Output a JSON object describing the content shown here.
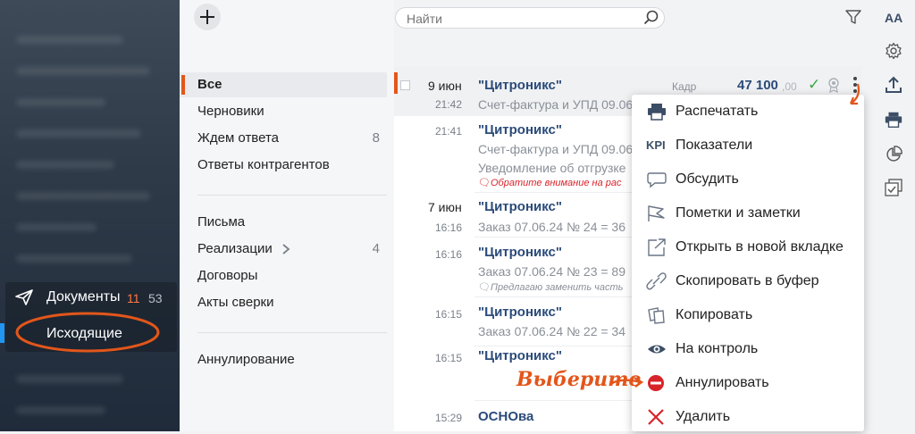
{
  "toolbar": {
    "search_placeholder": "Найти"
  },
  "nav": {
    "documents_label": "Документы",
    "documents_count_new": "11",
    "documents_count_total": "53",
    "outgoing_label": "Исходящие"
  },
  "folders": {
    "group1": [
      {
        "label": "Все",
        "count": ""
      },
      {
        "label": "Черновики",
        "count": ""
      },
      {
        "label": "Ждем ответа",
        "count": "8"
      },
      {
        "label": "Ответы контрагентов",
        "count": ""
      }
    ],
    "group2": [
      {
        "label": "Письма",
        "count": ""
      },
      {
        "label": "Реализации",
        "count": "4"
      },
      {
        "label": "Договоры",
        "count": ""
      },
      {
        "label": "Акты сверки",
        "count": ""
      }
    ],
    "group3": [
      {
        "label": "Аннулирование",
        "count": ""
      }
    ]
  },
  "list": {
    "rows": [
      {
        "date": "9 июн",
        "time": "21:42",
        "title": "\"Цитроникс\"",
        "sub1": "Счет-фактура и УПД 09.06",
        "sub2": "",
        "note": "",
        "tag": "Кадр",
        "amount_int": "47 100",
        "amount_dec": ",00"
      },
      {
        "date": "",
        "time": "21:41",
        "title": "\"Цитроникс\"",
        "sub1": "Счет-фактура и УПД 09.06",
        "sub2": "Уведомление об отгрузке",
        "note": "Обратите внимание на рас"
      },
      {
        "date": "7 июн",
        "time": "16:16",
        "title": "\"Цитроникс\"",
        "sub1": "Заказ 07.06.24 № 24 = 36"
      },
      {
        "date": "",
        "time": "16:16",
        "title": "\"Цитроникс\"",
        "sub1": "Заказ 07.06.24 № 23 = 89",
        "note": "Предлагаю заменить часть"
      },
      {
        "date": "",
        "time": "16:15",
        "title": "\"Цитроникс\"",
        "sub1": "Заказ 07.06.24 № 22 = 34"
      },
      {
        "date": "",
        "time": "16:15",
        "title": "\"Цитроникс\""
      },
      {
        "date": "",
        "time": "15:29",
        "title": "ОСНОва"
      }
    ]
  },
  "menu": {
    "items": [
      {
        "label": "Распечатать",
        "icon": "printer-icon"
      },
      {
        "label": "Показатели",
        "icon": "kpi-icon",
        "icon_text": "KPI"
      },
      {
        "label": "Обсудить",
        "icon": "chat-bubble-icon"
      },
      {
        "label": "Пометки и заметки",
        "icon": "flag-icon"
      },
      {
        "label": "Открыть в новой вкладке",
        "icon": "open-new-tab-icon"
      },
      {
        "label": "Скопировать в буфер",
        "icon": "link-icon"
      },
      {
        "label": "Копировать",
        "icon": "copy-icon"
      },
      {
        "label": "На контроль",
        "icon": "eye-icon"
      },
      {
        "label": "Аннулировать",
        "icon": "cancel-circle-icon"
      },
      {
        "label": "Удалить",
        "icon": "delete-x-icon"
      }
    ]
  },
  "annotation": {
    "hint_text": "Выберите"
  },
  "right_toolbar": {
    "font_size_label": "AA"
  },
  "colors": {
    "accent": "#e2561b",
    "link": "#2b4b7a",
    "danger": "#d8232a",
    "ok": "#3aa845"
  }
}
